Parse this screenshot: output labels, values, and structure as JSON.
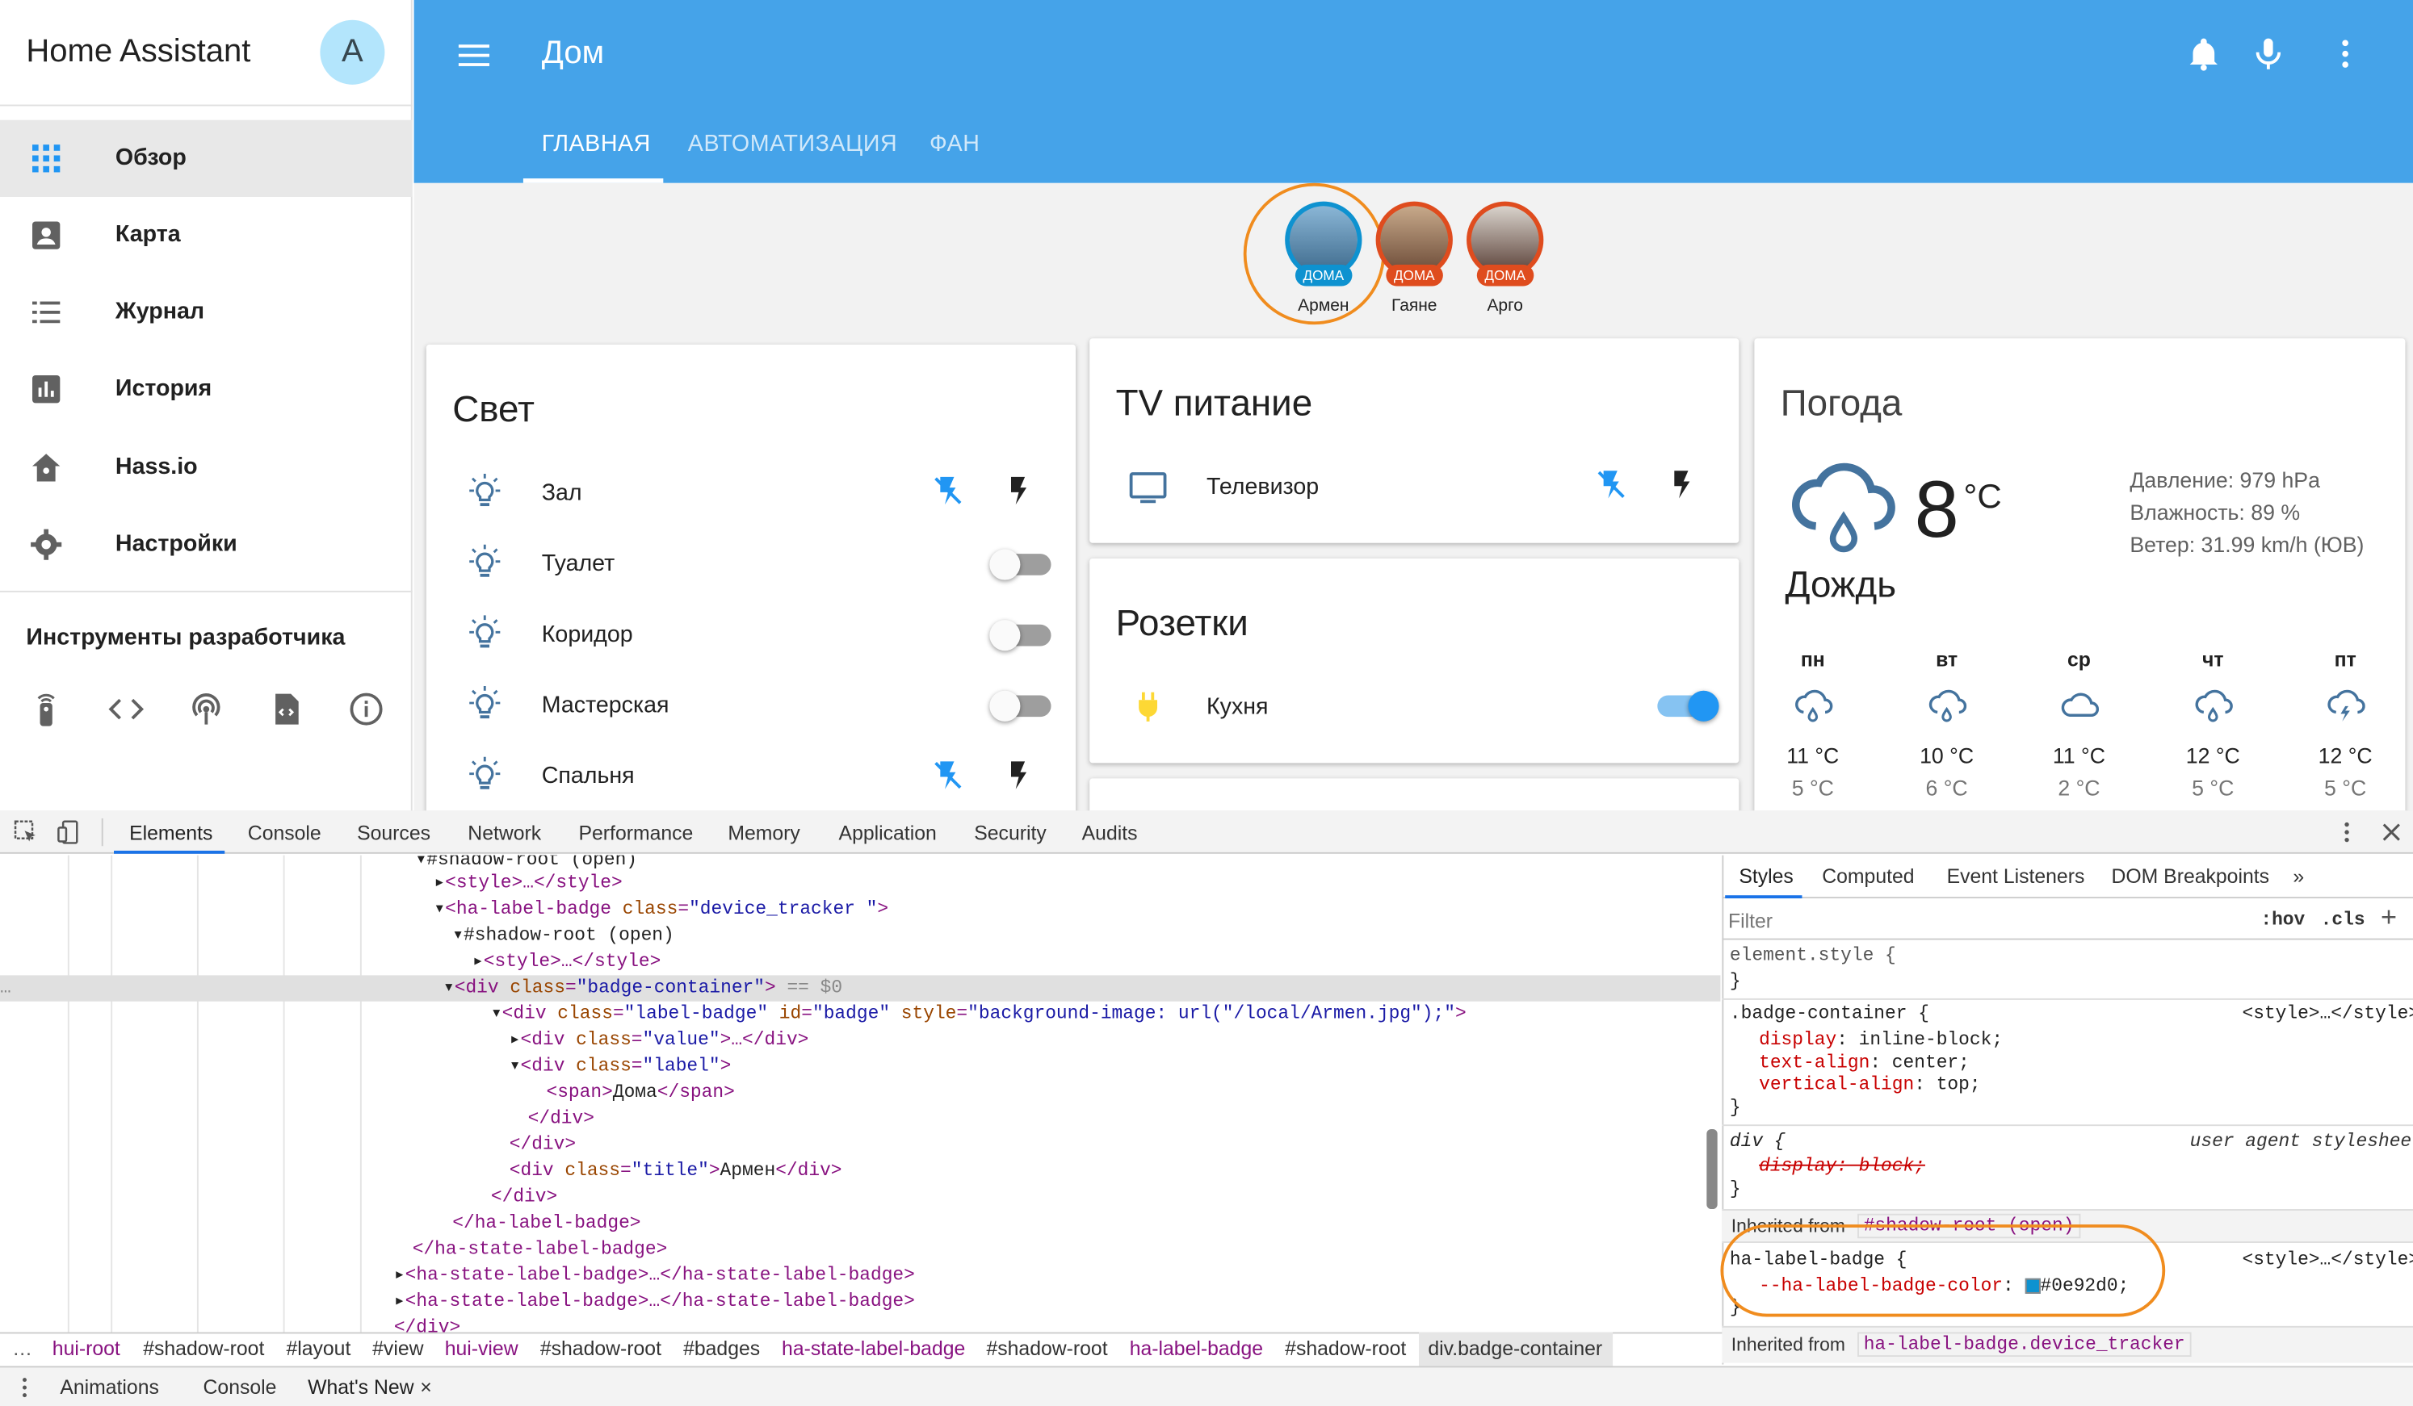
{
  "app": {
    "title": "Home Assistant",
    "avatar": "A"
  },
  "sidebar": {
    "items": [
      {
        "label": "Обзор",
        "icon": "grid-icon"
      },
      {
        "label": "Карта",
        "icon": "map-account-icon"
      },
      {
        "label": "Журнал",
        "icon": "list-icon"
      },
      {
        "label": "История",
        "icon": "chart-bar-icon"
      },
      {
        "label": "Hass.io",
        "icon": "home-assistant-icon"
      },
      {
        "label": "Настройки",
        "icon": "gear-icon"
      }
    ],
    "dev_title": "Инструменты разработчика"
  },
  "header": {
    "title": "Дом",
    "tabs": [
      "ГЛАВНАЯ",
      "АВТОМАТИЗАЦИЯ",
      "ФАН"
    ]
  },
  "badges": [
    {
      "name": "Армен",
      "state": "ДОМА"
    },
    {
      "name": "Гаяне",
      "state": "ДОМА"
    },
    {
      "name": "Арго",
      "state": "ДОМА"
    }
  ],
  "light": {
    "title": "Свет",
    "rows": [
      "Зал",
      "Туалет",
      "Коридор",
      "Мастерская",
      "Спальня"
    ]
  },
  "tv": {
    "title": "TV питание",
    "rows": [
      "Телевизор"
    ]
  },
  "sockets": {
    "title": "Розетки",
    "rows": [
      "Кухня"
    ]
  },
  "weather": {
    "title": "Погода",
    "temp": "8",
    "unit": "°C",
    "condition": "Дождь",
    "pressure": "Давление: 979 hPa",
    "humidity": "Влажность: 89 %",
    "wind": "Ветер: 31.99 km/h (ЮВ)",
    "forecast": [
      {
        "day": "пн",
        "hi": "11 °C",
        "lo": "5 °C",
        "icon": "rain-icon"
      },
      {
        "day": "вт",
        "hi": "10 °C",
        "lo": "6 °C",
        "icon": "rain-icon"
      },
      {
        "day": "ср",
        "hi": "11 °C",
        "lo": "2 °C",
        "icon": "cloud-icon"
      },
      {
        "day": "чт",
        "hi": "12 °C",
        "lo": "5 °C",
        "icon": "rain-icon"
      },
      {
        "day": "пт",
        "hi": "12 °C",
        "lo": "5 °C",
        "icon": "storm-icon"
      }
    ]
  },
  "devtools": {
    "tabs": [
      "Elements",
      "Console",
      "Sources",
      "Network",
      "Performance",
      "Memory",
      "Application",
      "Security",
      "Audits"
    ],
    "style_tabs": [
      "Styles",
      "Computed",
      "Event Listeners",
      "DOM Breakpoints"
    ],
    "filter_placeholder": "Filter",
    "hov": ":hov",
    "cls": ".cls",
    "crumbs": [
      "hui-root",
      "#shadow-root",
      "#layout",
      "#view",
      "hui-view",
      "#shadow-root",
      "#badges",
      "ha-state-label-badge",
      "#shadow-root",
      "ha-label-badge",
      "#shadow-root",
      "div.badge-container"
    ],
    "drawer": [
      "Animations",
      "Console",
      "What's New"
    ],
    "styles": {
      "element_style": "element.style {",
      "rule1_sel": ".badge-container {",
      "rule1_src": "<style>…</style>",
      "rule1_props": [
        [
          "display",
          "inline-block;"
        ],
        [
          "text-align",
          "center;"
        ],
        [
          "vertical-align",
          "top;"
        ]
      ],
      "rule2_sel": "div {",
      "rule2_src": "user agent stylesheet",
      "rule2_prop": "display: block;",
      "inherited1": "Inherited from",
      "inherited1_v": "#shadow-root (open)",
      "rule3_sel": "ha-label-badge {",
      "rule3_src": "<style>…</style>",
      "rule3_prop": "--ha-label-badge-color",
      "rule3_val": "#0e92d0;",
      "inherited2_v": "ha-label-badge.device_tracker"
    }
  },
  "colors": {
    "accent": "#45a3e9",
    "badge_blue": "#0e92d0",
    "badge_red": "#df4c1e",
    "highlight": "#f08c1e"
  }
}
